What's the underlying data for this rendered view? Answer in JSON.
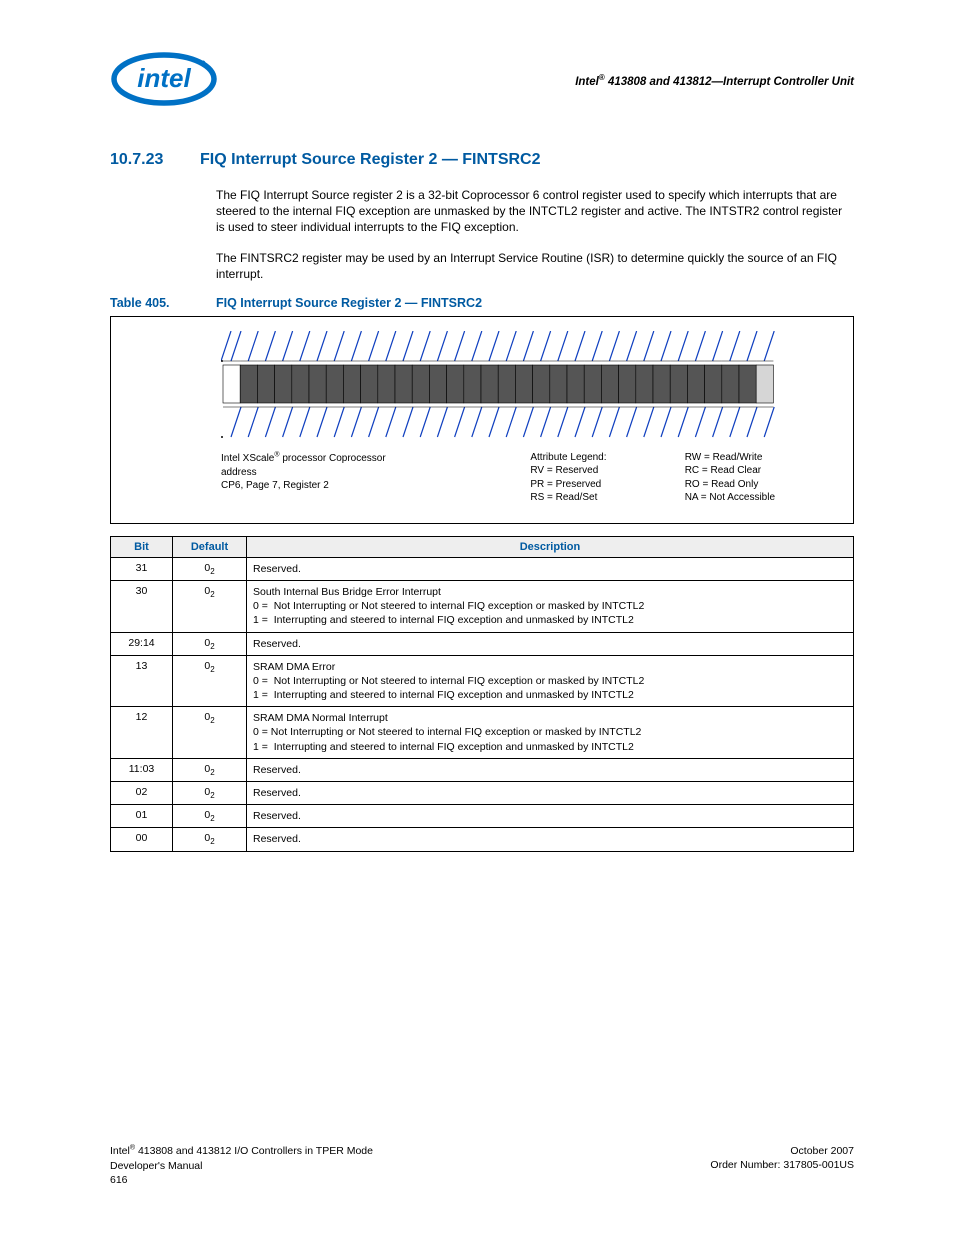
{
  "header": {
    "doc_title_html": "Intel<sup>®</sup> 413808 and 413812—Interrupt Controller Unit"
  },
  "section": {
    "number": "10.7.23",
    "title": "FIQ Interrupt Source Register 2 — FINTSRC2",
    "para1": "The FIQ Interrupt Source register 2 is a 32-bit Coprocessor 6 control register used to specify which interrupts that are steered to the internal FIQ exception are unmasked by the INTCTL2 register and active. The INTSTR2 control register is used to steer individual interrupts to the FIQ exception.",
    "para2": "The FINTSRC2 register may be used by an Interrupt Service Routine (ISR) to determine quickly the source of an FIQ interrupt."
  },
  "table": {
    "label": "Table 405.",
    "title": "FIQ Interrupt Source Register 2 — FINTSRC2"
  },
  "legend": {
    "col1_line1_html": "Intel XScale<sup>®</sup> processor Coprocessor",
    "col1_line2": "address",
    "col1_line3": "CP6, Page 7, Register 2",
    "col2_l1": "Attribute Legend:",
    "col2_l2": "RV = Reserved",
    "col2_l3": "PR = Preserved",
    "col2_l4": "RS = Read/Set",
    "col3_l1": "RW = Read/Write",
    "col3_l2": "RC = Read Clear",
    "col3_l3": "RO = Read Only",
    "col3_l4": "NA = Not Accessible"
  },
  "bits_table": {
    "headers": {
      "c1": "Bit",
      "c2": "Default",
      "c3": "Description"
    },
    "default_val_html": "0<span class=\"sub2\">2</span>",
    "rows": [
      {
        "bit": "31",
        "desc_html": "Reserved."
      },
      {
        "bit": "30",
        "desc_html": "South Internal Bus Bridge Error Interrupt<br>0 = &nbsp;Not Interrupting or Not steered to internal FIQ exception or masked by INTCTL2<br>1 = &nbsp;Interrupting and steered to internal FIQ exception and unmasked by INTCTL2"
      },
      {
        "bit": "29:14",
        "desc_html": "Reserved."
      },
      {
        "bit": "13",
        "desc_html": "SRAM DMA Error<br>0 = &nbsp;Not Interrupting or Not steered to internal FIQ exception or masked by INTCTL2<br>1 = &nbsp;Interrupting and steered to internal FIQ exception and unmasked by INTCTL2"
      },
      {
        "bit": "12",
        "desc_html": "SRAM DMA Normal Interrupt<br>0 = Not Interrupting or Not steered to internal FIQ exception or masked by INTCTL2<br>1 = &nbsp;Interrupting and steered to internal FIQ exception and unmasked by INTCTL2"
      },
      {
        "bit": "11:03",
        "desc_html": "Reserved."
      },
      {
        "bit": "02",
        "desc_html": "Reserved."
      },
      {
        "bit": "01",
        "desc_html": "Reserved."
      },
      {
        "bit": "00",
        "desc_html": "Reserved."
      }
    ]
  },
  "footer": {
    "left_line1_html": "Intel<sup>®</sup> 413808 and 413812 I/O Controllers in TPER Mode",
    "left_line2": "Developer's Manual",
    "left_line3": "616",
    "right_line1": "October 2007",
    "right_line2": "Order Number: 317805-001US"
  }
}
